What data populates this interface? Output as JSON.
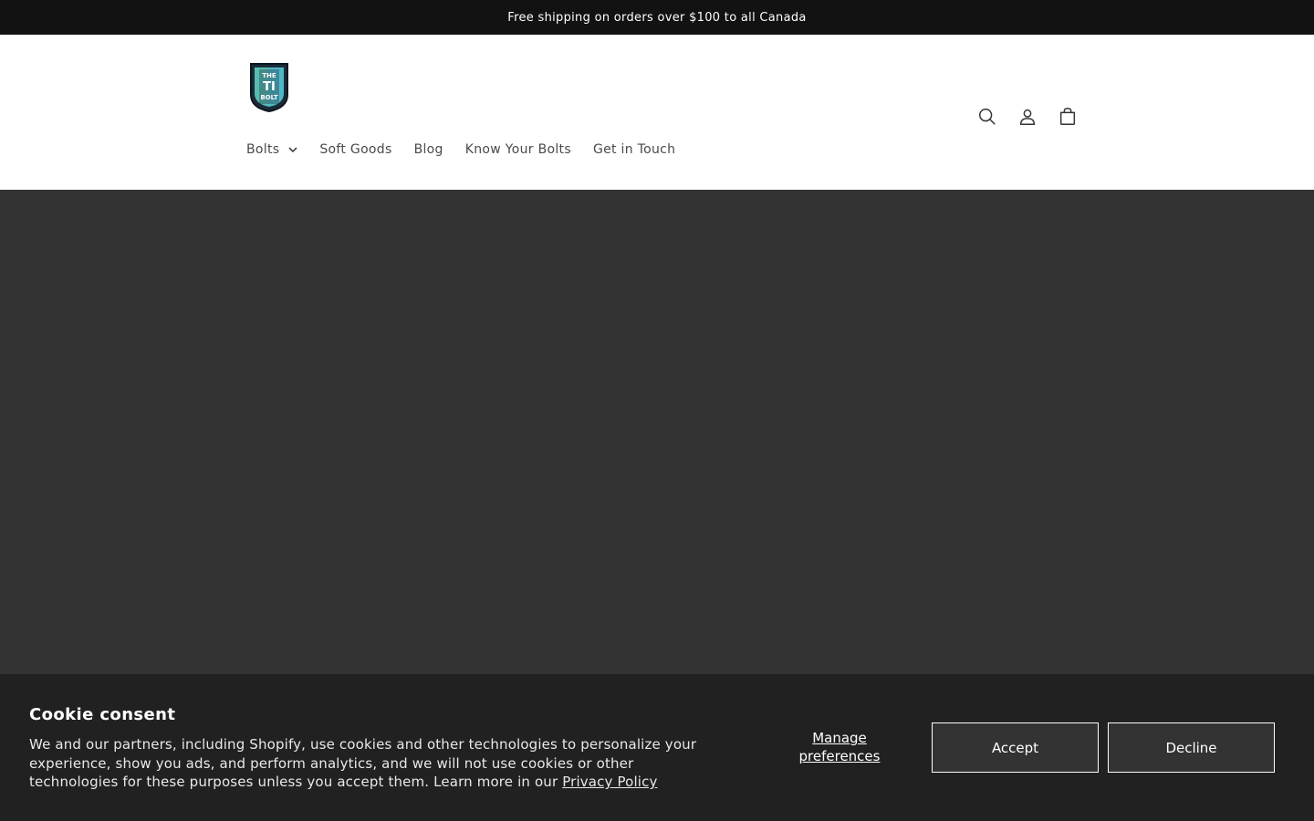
{
  "announcement": {
    "text": "Free shipping on orders over $100 to all Canada"
  },
  "header": {
    "logo_text_line1": "THE",
    "logo_text_line2": "TI",
    "logo_text_line3": "BOLT",
    "icons": [
      "search-icon",
      "account-icon",
      "cart-icon"
    ]
  },
  "nav": {
    "items": [
      {
        "label": "Bolts",
        "has_dropdown": true
      },
      {
        "label": "Soft Goods"
      },
      {
        "label": "Blog"
      },
      {
        "label": "Know Your Bolts"
      },
      {
        "label": "Get in Touch"
      }
    ]
  },
  "cookie": {
    "title": "Cookie consent",
    "body": "We and our partners, including Shopify, use cookies and other technologies to personalize your experience, show you ads, and perform analytics, and we will not use cookies or other technologies for these purposes unless you accept them. Learn more in our ",
    "privacy_link": "Privacy Policy",
    "manage_label": "Manage preferences",
    "accept_label": "Accept",
    "decline_label": "Decline"
  },
  "colors": {
    "announcement_bg": "#121212",
    "hero_bg": "#333333",
    "cookie_bg": "#212121"
  }
}
